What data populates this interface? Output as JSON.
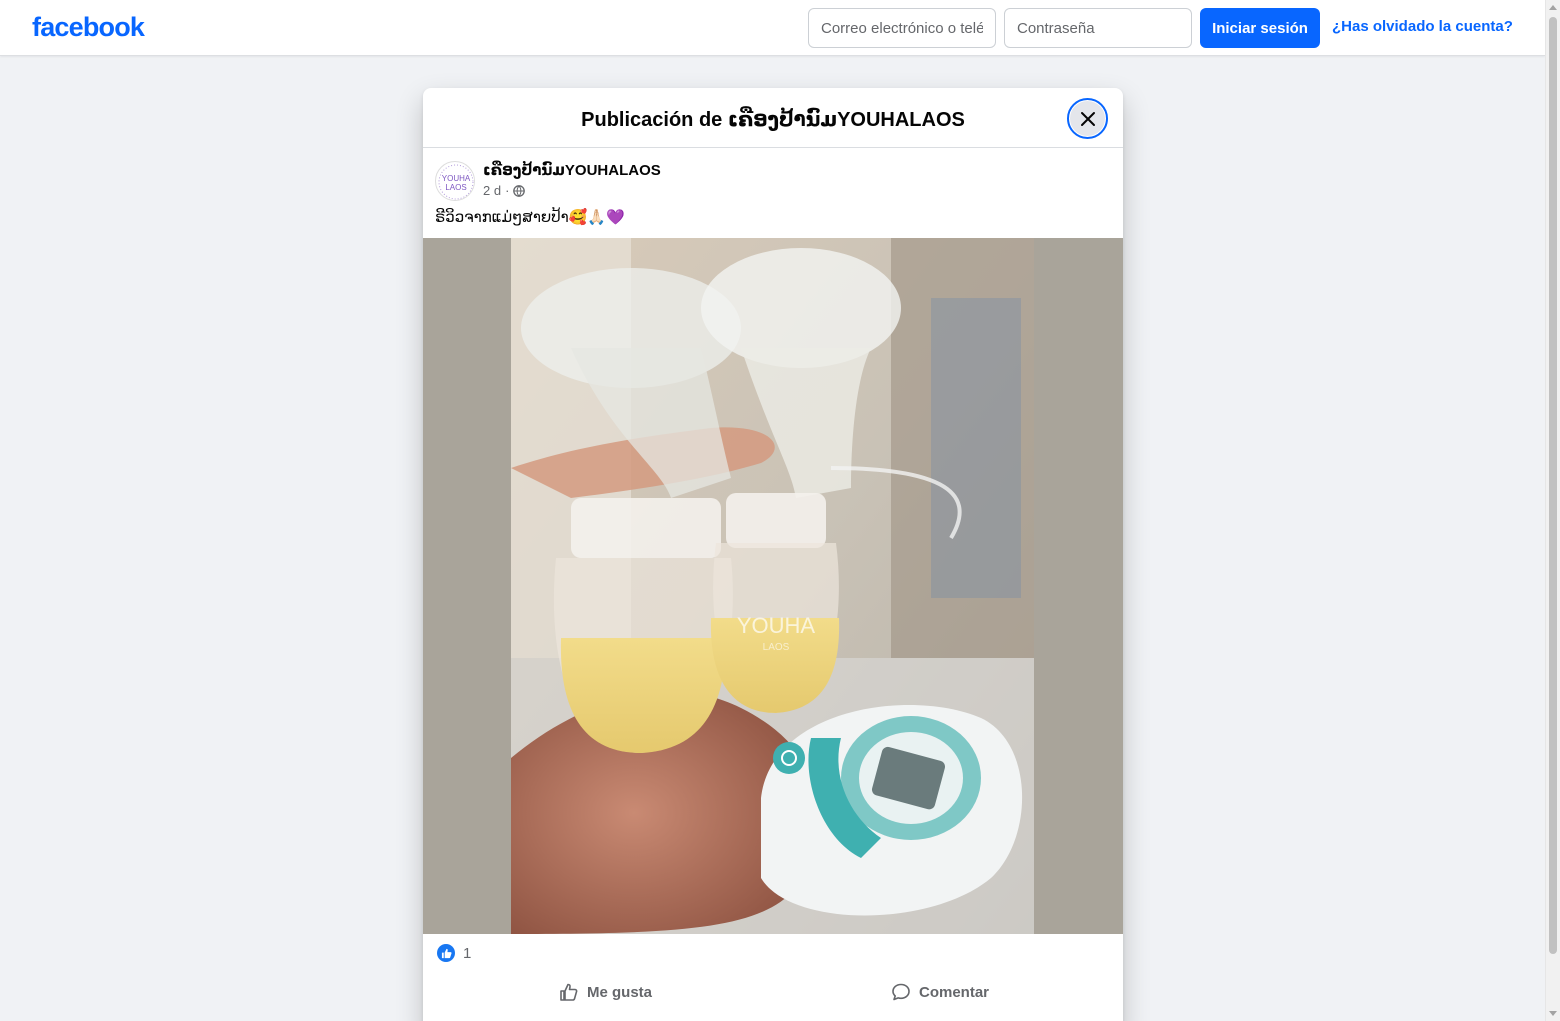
{
  "header": {
    "logo": "facebook",
    "email_placeholder": "Correo electrónico o teléfono",
    "password_placeholder": "Contraseña",
    "login_label": "Iniciar sesión",
    "forgot_label": "¿Has olvidado la cuenta?",
    "brand_color": "#0866ff"
  },
  "dialog": {
    "title": "Publicación de ເຄືອງປ້ານົມYOUHALAOS",
    "close_icon": "close-icon"
  },
  "post": {
    "page_name": "ເຄືອງປ້ານົມYOUHALAOS",
    "avatar_text_line1": "YOUHA",
    "avatar_text_line2": "LAOS",
    "time": "2 d",
    "separator": "·",
    "privacy_icon": "globe-icon",
    "caption": "ຣີວິວຈາກແມ່ໆສາຍປ້າ🥰🙏🏻💜",
    "photo_brand_text": "YOUHA",
    "photo_brand_sub": "LAOS",
    "reaction_count": "1",
    "like_label": "Me gusta",
    "comment_label": "Comentar"
  }
}
